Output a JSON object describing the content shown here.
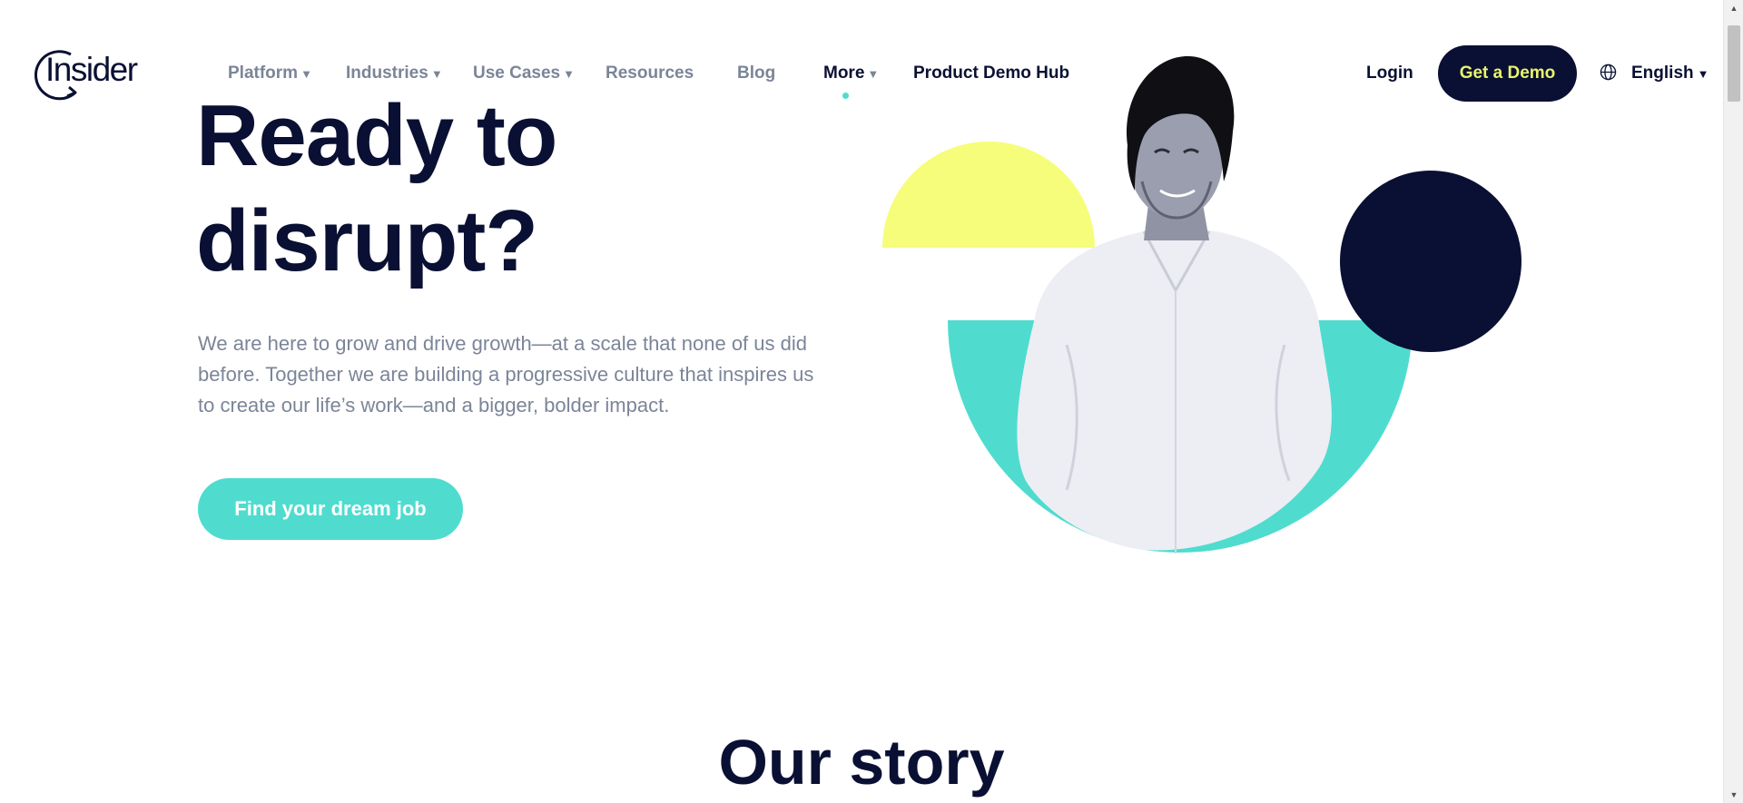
{
  "header": {
    "logo_text": "Insider",
    "nav": [
      {
        "label": "Platform",
        "has_dropdown": true
      },
      {
        "label": "Industries",
        "has_dropdown": true
      },
      {
        "label": "Use Cases",
        "has_dropdown": true
      },
      {
        "label": "Resources",
        "has_dropdown": false
      },
      {
        "label": "Blog",
        "has_dropdown": false
      },
      {
        "label": "More",
        "has_dropdown": true,
        "active": true
      },
      {
        "label": "Product Demo Hub",
        "has_dropdown": false
      }
    ],
    "caret": "▼",
    "login_label": "Login",
    "demo_label": "Get a Demo",
    "language": "English"
  },
  "hero": {
    "title": "Ready to disrupt?",
    "text": "We are here to grow and drive growth—at a scale that none of us did before. Together we are building a progressive culture that inspires us to create our life’s work—and a bigger, bolder impact.",
    "cta_label": "Find your dream job"
  },
  "story": {
    "title": "Our story"
  },
  "colors": {
    "navy": "#0a1033",
    "teal": "#4fdccf",
    "yellow": "#f6fd7a",
    "gray_text": "#7b8598",
    "demo_text": "#e9f56b"
  },
  "icons": {
    "globe": "globe-icon",
    "caret": "caret-down-icon"
  }
}
